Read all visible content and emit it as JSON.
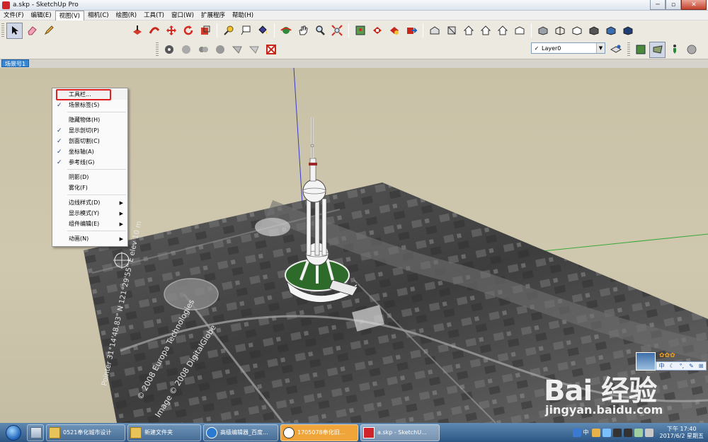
{
  "window": {
    "title": "a.skp - SketchUp Pro",
    "btn_min": "─",
    "btn_max": "▫",
    "btn_close": "✕"
  },
  "menubar": {
    "items": [
      "文件(F)",
      "编辑(E)",
      "视图(V)",
      "相机(C)",
      "绘图(R)",
      "工具(T)",
      "窗口(W)",
      "扩展程序",
      "帮助(H)"
    ]
  },
  "view_menu": {
    "items": [
      {
        "label": "工具栏...",
        "checked": false,
        "submenu": false
      },
      {
        "label": "场景标签(S)",
        "checked": true,
        "submenu": false
      },
      {
        "label": "隐藏物体(H)",
        "checked": false,
        "submenu": false
      },
      {
        "label": "显示剖切(P)",
        "checked": true,
        "submenu": false
      },
      {
        "label": "剖面切割(C)",
        "checked": true,
        "submenu": false
      },
      {
        "label": "坐标轴(A)",
        "checked": true,
        "submenu": false
      },
      {
        "label": "参考线(G)",
        "checked": true,
        "submenu": false
      },
      {
        "label": "阴影(D)",
        "checked": false,
        "submenu": false
      },
      {
        "label": "雾化(F)",
        "checked": false,
        "submenu": false
      },
      {
        "label": "边线样式(D)",
        "checked": false,
        "submenu": true
      },
      {
        "label": "显示模式(Y)",
        "checked": false,
        "submenu": true
      },
      {
        "label": "组件编辑(E)",
        "checked": false,
        "submenu": true
      },
      {
        "label": "动画(N)",
        "checked": false,
        "submenu": true
      }
    ],
    "check_glyph": "✓",
    "arrow_glyph": "▶"
  },
  "layer": {
    "check": "✓",
    "current": "Layer0",
    "dropdown_glyph": "▼"
  },
  "scene_tab": {
    "label": "场景号1"
  },
  "watermark": {
    "logo": "Bai  经验",
    "url": "jingyan.baidu.com"
  },
  "ime": {
    "stars": "✿✿✿",
    "symbols": [
      "中",
      "☾",
      "°,",
      "✎",
      "⊞"
    ]
  },
  "map_overlay": {
    "line1": "Image © 2008 DigitalGlobe",
    "line2": "© 2008 Europa Technologies",
    "line3": "Pointer 31°14'48.83\" N  121°29'55\" E  elev 10 m"
  },
  "taskbar": {
    "buttons": [
      {
        "label": "0521奉化城市设计",
        "icon": "folder-icon",
        "active": false
      },
      {
        "label": "新建文件夹",
        "icon": "folder-icon",
        "active": false
      },
      {
        "label": "高级编辑器_百度...",
        "icon": "browser-icon",
        "active": false
      },
      {
        "label": "1705078奉化旧...",
        "icon": "chat-icon",
        "active": false
      },
      {
        "label": "a.skp - SketchU...",
        "icon": "sketchup-icon",
        "active": true
      }
    ],
    "tray_text": "中",
    "time": "下午 17:40",
    "date": "2017/6/2 星期五"
  },
  "colors": {
    "accent_red": "#e02020",
    "scene_tab_blue": "#3a86d0",
    "taskbar_top": "#5f8ab3",
    "taskbar_bottom": "#2c5583"
  }
}
